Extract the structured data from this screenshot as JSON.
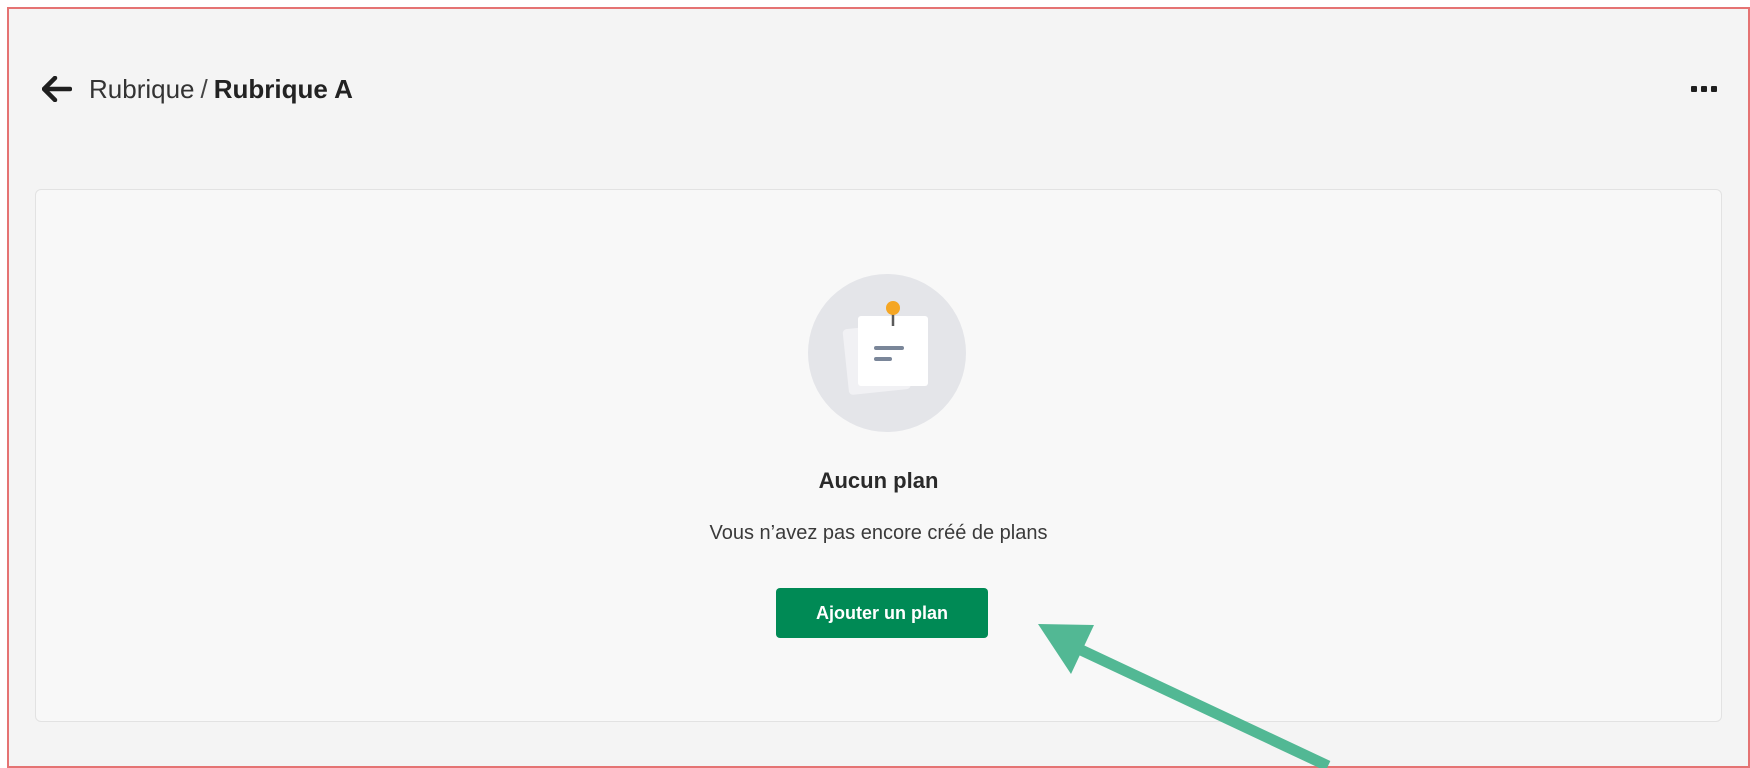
{
  "header": {
    "breadcrumb_parent": "Rubrique",
    "breadcrumb_separator": "/",
    "breadcrumb_current": "Rubrique A"
  },
  "icons": {
    "back": "arrow-left-icon",
    "more": "more-horizontal-icon",
    "empty_state": "pinned-note-icon"
  },
  "empty_state": {
    "title": "Aucun plan",
    "subtitle": "Vous n’avez pas encore créé de plans",
    "action_label": "Ajouter un plan"
  },
  "colors": {
    "primary_button": "#008a55",
    "annotation_arrow": "#52b894",
    "frame_border": "#e57373",
    "pin": "#f5a623"
  }
}
